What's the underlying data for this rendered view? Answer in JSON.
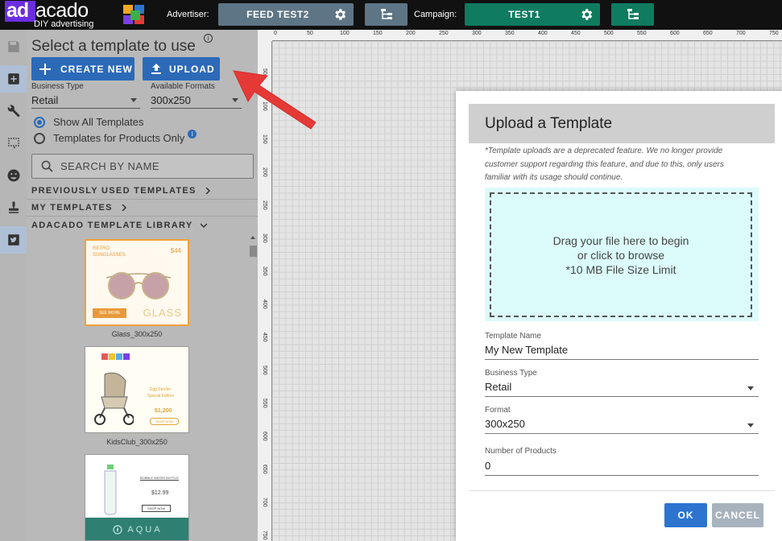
{
  "header": {
    "logo_primary": "ad",
    "logo_secondary": "acado",
    "logo_tagline": "DIY advertising",
    "advertiser_label": "Advertiser:",
    "advertiser_value": "FEED TEST2",
    "campaign_label": "Campaign:",
    "campaign_value": "TEST1",
    "colors": {
      "advertiser_bg": "#5e7585",
      "campaign_bg": "#0f7b5f",
      "brand": "#6b2de0"
    }
  },
  "rail": {
    "items": [
      "save-icon",
      "add-icon",
      "tools-icon",
      "select-icon",
      "smiley-icon",
      "stamp-icon",
      "twitter-icon"
    ]
  },
  "panel": {
    "title": "Select a template to use",
    "info_glyph": "i",
    "create_label": "CREATE NEW",
    "upload_label": "UPLOAD",
    "business_type_label": "Business Type",
    "business_type_value": "Retail",
    "formats_label": "Available Formats",
    "formats_value": "300x250",
    "radio_all": "Show All Templates",
    "radio_products": "Templates for Products Only",
    "search_placeholder": "SEARCH BY NAME",
    "section_previous": "PREVIOUSLY USED TEMPLATES",
    "section_mine": "MY TEMPLATES",
    "section_library": "ADACADO TEMPLATE LIBRARY",
    "templates": [
      {
        "name": "Glass_300x250",
        "line1": "RETRO",
        "line2": "SUNGLASSES",
        "price": "$44",
        "cta": "SEE MORE",
        "brand": "GLASS"
      },
      {
        "name": "KidsClub_300x250",
        "line1": "Egg Stroller",
        "line2": "Special Edition",
        "price": "$1,200",
        "cta": "SHOP NOW"
      },
      {
        "name": "Aqua",
        "title": "BOBBLE WATER BOTTLE",
        "price": "$12.99",
        "cta": "SHOP NOW",
        "brand": "AQUA"
      }
    ]
  },
  "ruler": {
    "top_ticks": [
      "0",
      "50",
      "100",
      "150",
      "200",
      "250",
      "300",
      "350",
      "400",
      "450",
      "500",
      "550",
      "600",
      "650",
      "700",
      "750"
    ],
    "left_ticks": [
      "50",
      "100",
      "150",
      "200",
      "250",
      "300",
      "350",
      "400",
      "450",
      "500",
      "550",
      "600",
      "650",
      "700",
      "750"
    ]
  },
  "modal": {
    "title": "Upload a Template",
    "note": "*Template uploads are a deprecated feature. We no longer provide customer support regarding this feature, and due to this, only users familiar with its usage should continue.",
    "drop_line1": "Drag your file here to begin",
    "drop_line2": "or click to browse",
    "drop_line3": "*10 MB File Size Limit",
    "name_label": "Template Name",
    "name_value": "My New Template",
    "business_label": "Business Type",
    "business_value": "Retail",
    "format_label": "Format",
    "format_value": "300x250",
    "products_label": "Number of Products",
    "products_value": "0",
    "ok_label": "OK",
    "cancel_label": "CANCEL"
  }
}
